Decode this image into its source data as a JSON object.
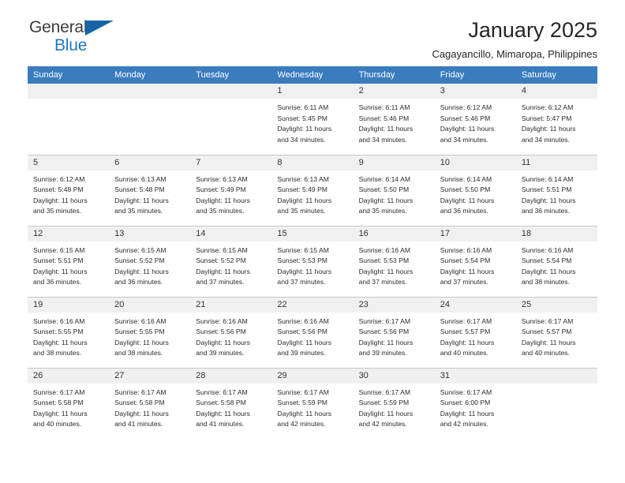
{
  "brand": {
    "name_part1": "General",
    "name_part2": "Blue",
    "flag_icon": "blue-flag-icon",
    "accent_color": "#1f77c4",
    "flag_color": "#1763a6"
  },
  "header": {
    "title": "January 2025",
    "subtitle": "Cagayancillo, Mimaropa, Philippines"
  },
  "calendar": {
    "header_color": "#3a7cbe",
    "daynum_bg": "#f0f0f0",
    "weekday_headers": [
      "Sunday",
      "Monday",
      "Tuesday",
      "Wednesday",
      "Thursday",
      "Friday",
      "Saturday"
    ],
    "weeks": [
      [
        {
          "day": "",
          "sunrise": "",
          "sunset": "",
          "daylight_line1": "",
          "daylight_line2": ""
        },
        {
          "day": "",
          "sunrise": "",
          "sunset": "",
          "daylight_line1": "",
          "daylight_line2": ""
        },
        {
          "day": "",
          "sunrise": "",
          "sunset": "",
          "daylight_line1": "",
          "daylight_line2": ""
        },
        {
          "day": "1",
          "sunrise": "Sunrise: 6:11 AM",
          "sunset": "Sunset: 5:45 PM",
          "daylight_line1": "Daylight: 11 hours",
          "daylight_line2": "and 34 minutes."
        },
        {
          "day": "2",
          "sunrise": "Sunrise: 6:11 AM",
          "sunset": "Sunset: 5:46 PM",
          "daylight_line1": "Daylight: 11 hours",
          "daylight_line2": "and 34 minutes."
        },
        {
          "day": "3",
          "sunrise": "Sunrise: 6:12 AM",
          "sunset": "Sunset: 5:46 PM",
          "daylight_line1": "Daylight: 11 hours",
          "daylight_line2": "and 34 minutes."
        },
        {
          "day": "4",
          "sunrise": "Sunrise: 6:12 AM",
          "sunset": "Sunset: 5:47 PM",
          "daylight_line1": "Daylight: 11 hours",
          "daylight_line2": "and 34 minutes."
        }
      ],
      [
        {
          "day": "5",
          "sunrise": "Sunrise: 6:12 AM",
          "sunset": "Sunset: 5:48 PM",
          "daylight_line1": "Daylight: 11 hours",
          "daylight_line2": "and 35 minutes."
        },
        {
          "day": "6",
          "sunrise": "Sunrise: 6:13 AM",
          "sunset": "Sunset: 5:48 PM",
          "daylight_line1": "Daylight: 11 hours",
          "daylight_line2": "and 35 minutes."
        },
        {
          "day": "7",
          "sunrise": "Sunrise: 6:13 AM",
          "sunset": "Sunset: 5:49 PM",
          "daylight_line1": "Daylight: 11 hours",
          "daylight_line2": "and 35 minutes."
        },
        {
          "day": "8",
          "sunrise": "Sunrise: 6:13 AM",
          "sunset": "Sunset: 5:49 PM",
          "daylight_line1": "Daylight: 11 hours",
          "daylight_line2": "and 35 minutes."
        },
        {
          "day": "9",
          "sunrise": "Sunrise: 6:14 AM",
          "sunset": "Sunset: 5:50 PM",
          "daylight_line1": "Daylight: 11 hours",
          "daylight_line2": "and 35 minutes."
        },
        {
          "day": "10",
          "sunrise": "Sunrise: 6:14 AM",
          "sunset": "Sunset: 5:50 PM",
          "daylight_line1": "Daylight: 11 hours",
          "daylight_line2": "and 36 minutes."
        },
        {
          "day": "11",
          "sunrise": "Sunrise: 6:14 AM",
          "sunset": "Sunset: 5:51 PM",
          "daylight_line1": "Daylight: 11 hours",
          "daylight_line2": "and 36 minutes."
        }
      ],
      [
        {
          "day": "12",
          "sunrise": "Sunrise: 6:15 AM",
          "sunset": "Sunset: 5:51 PM",
          "daylight_line1": "Daylight: 11 hours",
          "daylight_line2": "and 36 minutes."
        },
        {
          "day": "13",
          "sunrise": "Sunrise: 6:15 AM",
          "sunset": "Sunset: 5:52 PM",
          "daylight_line1": "Daylight: 11 hours",
          "daylight_line2": "and 36 minutes."
        },
        {
          "day": "14",
          "sunrise": "Sunrise: 6:15 AM",
          "sunset": "Sunset: 5:52 PM",
          "daylight_line1": "Daylight: 11 hours",
          "daylight_line2": "and 37 minutes."
        },
        {
          "day": "15",
          "sunrise": "Sunrise: 6:15 AM",
          "sunset": "Sunset: 5:53 PM",
          "daylight_line1": "Daylight: 11 hours",
          "daylight_line2": "and 37 minutes."
        },
        {
          "day": "16",
          "sunrise": "Sunrise: 6:16 AM",
          "sunset": "Sunset: 5:53 PM",
          "daylight_line1": "Daylight: 11 hours",
          "daylight_line2": "and 37 minutes."
        },
        {
          "day": "17",
          "sunrise": "Sunrise: 6:16 AM",
          "sunset": "Sunset: 5:54 PM",
          "daylight_line1": "Daylight: 11 hours",
          "daylight_line2": "and 37 minutes."
        },
        {
          "day": "18",
          "sunrise": "Sunrise: 6:16 AM",
          "sunset": "Sunset: 5:54 PM",
          "daylight_line1": "Daylight: 11 hours",
          "daylight_line2": "and 38 minutes."
        }
      ],
      [
        {
          "day": "19",
          "sunrise": "Sunrise: 6:16 AM",
          "sunset": "Sunset: 5:55 PM",
          "daylight_line1": "Daylight: 11 hours",
          "daylight_line2": "and 38 minutes."
        },
        {
          "day": "20",
          "sunrise": "Sunrise: 6:16 AM",
          "sunset": "Sunset: 5:55 PM",
          "daylight_line1": "Daylight: 11 hours",
          "daylight_line2": "and 38 minutes."
        },
        {
          "day": "21",
          "sunrise": "Sunrise: 6:16 AM",
          "sunset": "Sunset: 5:56 PM",
          "daylight_line1": "Daylight: 11 hours",
          "daylight_line2": "and 39 minutes."
        },
        {
          "day": "22",
          "sunrise": "Sunrise: 6:16 AM",
          "sunset": "Sunset: 5:56 PM",
          "daylight_line1": "Daylight: 11 hours",
          "daylight_line2": "and 39 minutes."
        },
        {
          "day": "23",
          "sunrise": "Sunrise: 6:17 AM",
          "sunset": "Sunset: 5:56 PM",
          "daylight_line1": "Daylight: 11 hours",
          "daylight_line2": "and 39 minutes."
        },
        {
          "day": "24",
          "sunrise": "Sunrise: 6:17 AM",
          "sunset": "Sunset: 5:57 PM",
          "daylight_line1": "Daylight: 11 hours",
          "daylight_line2": "and 40 minutes."
        },
        {
          "day": "25",
          "sunrise": "Sunrise: 6:17 AM",
          "sunset": "Sunset: 5:57 PM",
          "daylight_line1": "Daylight: 11 hours",
          "daylight_line2": "and 40 minutes."
        }
      ],
      [
        {
          "day": "26",
          "sunrise": "Sunrise: 6:17 AM",
          "sunset": "Sunset: 5:58 PM",
          "daylight_line1": "Daylight: 11 hours",
          "daylight_line2": "and 40 minutes."
        },
        {
          "day": "27",
          "sunrise": "Sunrise: 6:17 AM",
          "sunset": "Sunset: 5:58 PM",
          "daylight_line1": "Daylight: 11 hours",
          "daylight_line2": "and 41 minutes."
        },
        {
          "day": "28",
          "sunrise": "Sunrise: 6:17 AM",
          "sunset": "Sunset: 5:58 PM",
          "daylight_line1": "Daylight: 11 hours",
          "daylight_line2": "and 41 minutes."
        },
        {
          "day": "29",
          "sunrise": "Sunrise: 6:17 AM",
          "sunset": "Sunset: 5:59 PM",
          "daylight_line1": "Daylight: 11 hours",
          "daylight_line2": "and 42 minutes."
        },
        {
          "day": "30",
          "sunrise": "Sunrise: 6:17 AM",
          "sunset": "Sunset: 5:59 PM",
          "daylight_line1": "Daylight: 11 hours",
          "daylight_line2": "and 42 minutes."
        },
        {
          "day": "31",
          "sunrise": "Sunrise: 6:17 AM",
          "sunset": "Sunset: 6:00 PM",
          "daylight_line1": "Daylight: 11 hours",
          "daylight_line2": "and 42 minutes."
        },
        {
          "day": "",
          "sunrise": "",
          "sunset": "",
          "daylight_line1": "",
          "daylight_line2": ""
        }
      ]
    ]
  }
}
